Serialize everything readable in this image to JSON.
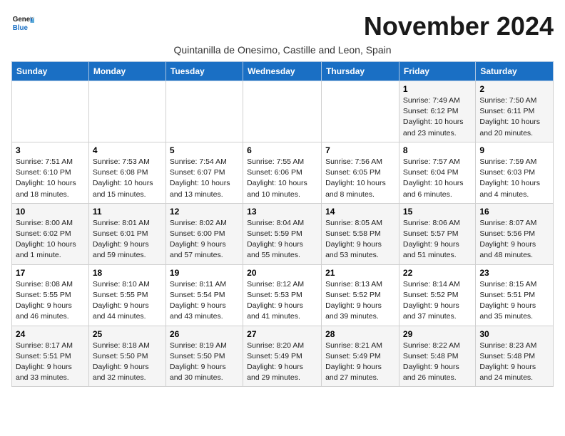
{
  "header": {
    "logo_line1": "General",
    "logo_line2": "Blue",
    "month_title": "November 2024",
    "subtitle": "Quintanilla de Onesimo, Castille and Leon, Spain"
  },
  "days_of_week": [
    "Sunday",
    "Monday",
    "Tuesday",
    "Wednesday",
    "Thursday",
    "Friday",
    "Saturday"
  ],
  "weeks": [
    [
      {
        "day": "",
        "info": ""
      },
      {
        "day": "",
        "info": ""
      },
      {
        "day": "",
        "info": ""
      },
      {
        "day": "",
        "info": ""
      },
      {
        "day": "",
        "info": ""
      },
      {
        "day": "1",
        "info": "Sunrise: 7:49 AM\nSunset: 6:12 PM\nDaylight: 10 hours and 23 minutes."
      },
      {
        "day": "2",
        "info": "Sunrise: 7:50 AM\nSunset: 6:11 PM\nDaylight: 10 hours and 20 minutes."
      }
    ],
    [
      {
        "day": "3",
        "info": "Sunrise: 7:51 AM\nSunset: 6:10 PM\nDaylight: 10 hours and 18 minutes."
      },
      {
        "day": "4",
        "info": "Sunrise: 7:53 AM\nSunset: 6:08 PM\nDaylight: 10 hours and 15 minutes."
      },
      {
        "day": "5",
        "info": "Sunrise: 7:54 AM\nSunset: 6:07 PM\nDaylight: 10 hours and 13 minutes."
      },
      {
        "day": "6",
        "info": "Sunrise: 7:55 AM\nSunset: 6:06 PM\nDaylight: 10 hours and 10 minutes."
      },
      {
        "day": "7",
        "info": "Sunrise: 7:56 AM\nSunset: 6:05 PM\nDaylight: 10 hours and 8 minutes."
      },
      {
        "day": "8",
        "info": "Sunrise: 7:57 AM\nSunset: 6:04 PM\nDaylight: 10 hours and 6 minutes."
      },
      {
        "day": "9",
        "info": "Sunrise: 7:59 AM\nSunset: 6:03 PM\nDaylight: 10 hours and 4 minutes."
      }
    ],
    [
      {
        "day": "10",
        "info": "Sunrise: 8:00 AM\nSunset: 6:02 PM\nDaylight: 10 hours and 1 minute."
      },
      {
        "day": "11",
        "info": "Sunrise: 8:01 AM\nSunset: 6:01 PM\nDaylight: 9 hours and 59 minutes."
      },
      {
        "day": "12",
        "info": "Sunrise: 8:02 AM\nSunset: 6:00 PM\nDaylight: 9 hours and 57 minutes."
      },
      {
        "day": "13",
        "info": "Sunrise: 8:04 AM\nSunset: 5:59 PM\nDaylight: 9 hours and 55 minutes."
      },
      {
        "day": "14",
        "info": "Sunrise: 8:05 AM\nSunset: 5:58 PM\nDaylight: 9 hours and 53 minutes."
      },
      {
        "day": "15",
        "info": "Sunrise: 8:06 AM\nSunset: 5:57 PM\nDaylight: 9 hours and 51 minutes."
      },
      {
        "day": "16",
        "info": "Sunrise: 8:07 AM\nSunset: 5:56 PM\nDaylight: 9 hours and 48 minutes."
      }
    ],
    [
      {
        "day": "17",
        "info": "Sunrise: 8:08 AM\nSunset: 5:55 PM\nDaylight: 9 hours and 46 minutes."
      },
      {
        "day": "18",
        "info": "Sunrise: 8:10 AM\nSunset: 5:55 PM\nDaylight: 9 hours and 44 minutes."
      },
      {
        "day": "19",
        "info": "Sunrise: 8:11 AM\nSunset: 5:54 PM\nDaylight: 9 hours and 43 minutes."
      },
      {
        "day": "20",
        "info": "Sunrise: 8:12 AM\nSunset: 5:53 PM\nDaylight: 9 hours and 41 minutes."
      },
      {
        "day": "21",
        "info": "Sunrise: 8:13 AM\nSunset: 5:52 PM\nDaylight: 9 hours and 39 minutes."
      },
      {
        "day": "22",
        "info": "Sunrise: 8:14 AM\nSunset: 5:52 PM\nDaylight: 9 hours and 37 minutes."
      },
      {
        "day": "23",
        "info": "Sunrise: 8:15 AM\nSunset: 5:51 PM\nDaylight: 9 hours and 35 minutes."
      }
    ],
    [
      {
        "day": "24",
        "info": "Sunrise: 8:17 AM\nSunset: 5:51 PM\nDaylight: 9 hours and 33 minutes."
      },
      {
        "day": "25",
        "info": "Sunrise: 8:18 AM\nSunset: 5:50 PM\nDaylight: 9 hours and 32 minutes."
      },
      {
        "day": "26",
        "info": "Sunrise: 8:19 AM\nSunset: 5:50 PM\nDaylight: 9 hours and 30 minutes."
      },
      {
        "day": "27",
        "info": "Sunrise: 8:20 AM\nSunset: 5:49 PM\nDaylight: 9 hours and 29 minutes."
      },
      {
        "day": "28",
        "info": "Sunrise: 8:21 AM\nSunset: 5:49 PM\nDaylight: 9 hours and 27 minutes."
      },
      {
        "day": "29",
        "info": "Sunrise: 8:22 AM\nSunset: 5:48 PM\nDaylight: 9 hours and 26 minutes."
      },
      {
        "day": "30",
        "info": "Sunrise: 8:23 AM\nSunset: 5:48 PM\nDaylight: 9 hours and 24 minutes."
      }
    ]
  ]
}
